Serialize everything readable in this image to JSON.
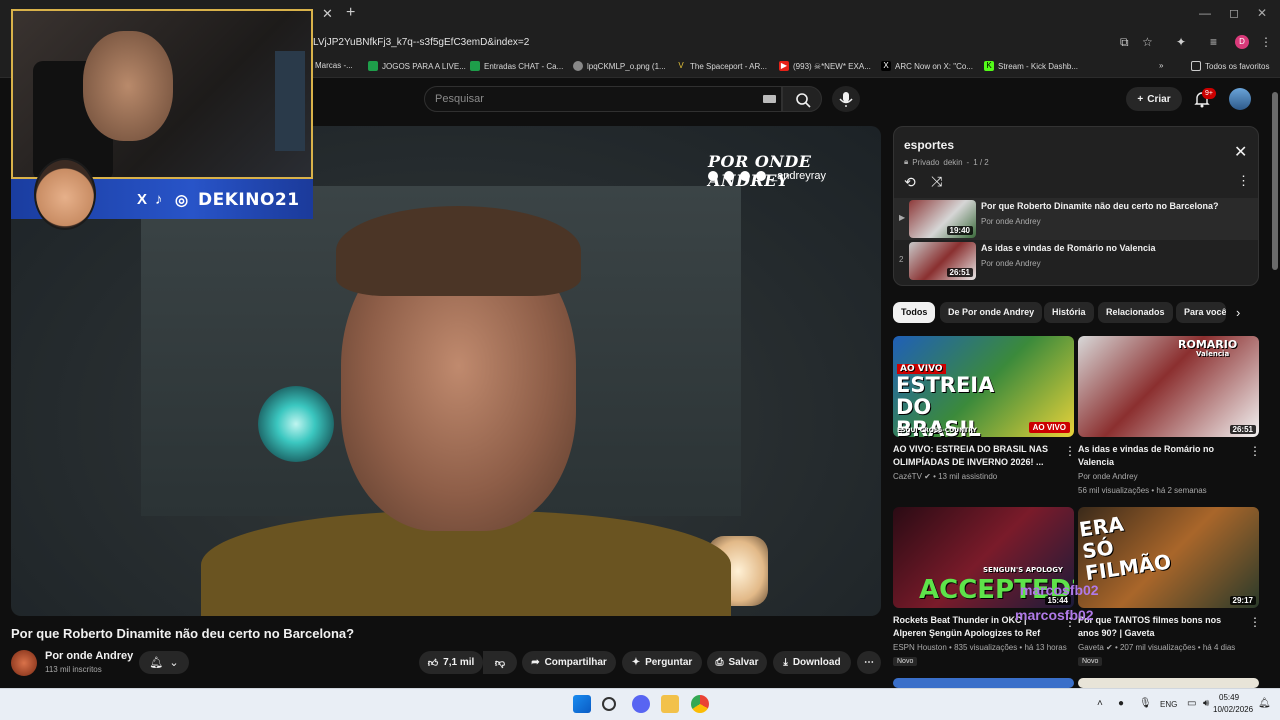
{
  "browser": {
    "url": "LVjJP2YuBNfkFj3_k7q--s3f5gEfC3emD&index=2",
    "profile_initial": "D",
    "bookmarks": [
      "Marcas -...",
      "JOGOS PARA A LIVE...",
      "Entradas CHAT - Ca...",
      "lpqCKMLP_o.png (1...",
      "The Spaceport - AR...",
      "(993) ☠*NEW* EXA...",
      "ARC Now on X: \"Co...",
      "Stream - Kick Dashb..."
    ],
    "bookmarks_folder": "Todos os favoritos"
  },
  "header": {
    "search_placeholder": "Pesquisar",
    "create_label": "Criar",
    "notifications_badge": "9+"
  },
  "overlay": {
    "streamer_handle": "DEKINO21",
    "chat_overlay_1": "marcosfb02",
    "chat_overlay_2": "marcosfb02"
  },
  "player": {
    "watermark_title": "POR ONDE ANDREY",
    "watermark_handle": "_andreyray"
  },
  "video": {
    "title": "Por que Roberto Dinamite não deu certo no Barcelona?",
    "channel": "Por onde Andrey",
    "subscribers": "113 mil inscritos",
    "likes": "7,1 mil",
    "share_label": "Compartilhar",
    "ask_label": "Perguntar",
    "save_label": "Salvar",
    "download_label": "Download"
  },
  "playlist": {
    "title": "esportes",
    "privacy": "Privado",
    "owner": "dekin",
    "position": "1 / 2",
    "items": [
      {
        "index": "▶",
        "title": "Por que Roberto Dinamite não deu certo no Barcelona?",
        "channel": "Por onde Andrey",
        "duration": "19:40"
      },
      {
        "index": "2",
        "title": "As idas e vindas de Romário no Valencia",
        "channel": "Por onde Andrey",
        "duration": "26:51"
      }
    ]
  },
  "chips": [
    "Todos",
    "De Por onde Andrey",
    "História",
    "Relacionados",
    "Para você"
  ],
  "recommendations": [
    {
      "title": "AO VIVO: ESTREIA DO BRASIL NAS OLIMPÍADAS DE INVERNO 2026! ...",
      "channel": "CazéTV",
      "meta": "13 mil assistindo",
      "badge": "AO VIVO",
      "thumb_tag": "AO VIVO",
      "thumb_text": "ESTREIA DO BRASIL",
      "thumb_sub": "ESQUI CROSS-COUNTRY"
    },
    {
      "title": "As idas e vindas de Romário no Valencia",
      "channel": "Por onde Andrey",
      "meta": "56 mil visualizações • há 2 semanas",
      "duration": "26:51",
      "thumb_text": "ROMARIO",
      "thumb_sub": "Valencia"
    },
    {
      "title": "Rockets Beat Thunder in OKC | Alperen Şengün Apologizes to Ref",
      "channel": "ESPN Houston",
      "meta": "835 visualizações • há 13 horas",
      "duration": "15:44",
      "badge_new": "Novo",
      "thumb_text": "ACCEPTED?!",
      "thumb_sub": "SENGUN'S APOLOGY"
    },
    {
      "title": "Por que TANTOS filmes bons nos anos 90? | Gaveta",
      "channel": "Gaveta",
      "meta": "207 mil visualizações • há 4 dias",
      "duration": "29:17",
      "badge_new": "Novo",
      "thumb_text": "ERA SÓ FILMÃO"
    }
  ],
  "taskbar": {
    "lang": "ENG",
    "time": "05:49",
    "date": "10/02/2026"
  }
}
